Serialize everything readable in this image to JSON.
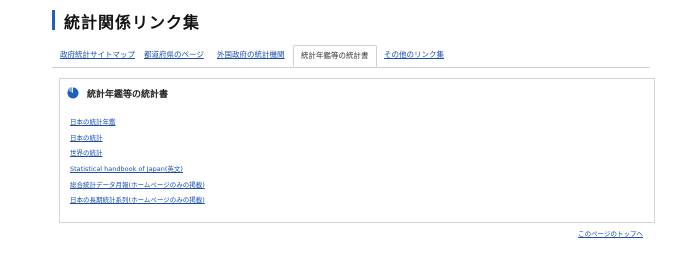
{
  "page": {
    "title": "統計関係リンク集"
  },
  "tabs": [
    {
      "label": "政府統計サイトマップ"
    },
    {
      "label": "都道府県のページ"
    },
    {
      "label": "外国政府の統計機関"
    },
    {
      "label": "統計年鑑等の統計書",
      "active": true
    },
    {
      "label": "その他のリンク集"
    }
  ],
  "section": {
    "title": "統計年鑑等の統計書",
    "icon": "pie-chart-icon",
    "links": [
      {
        "label": "日本の統計年鑑"
      },
      {
        "label": "日本の統計"
      },
      {
        "label": "世界の統計"
      },
      {
        "label": "Statistical handbook of Japan(英文)"
      },
      {
        "label": "総合統計データ月報(ホームページのみの掲載)"
      },
      {
        "label": "日本の長期統計系列(ホームページのみの掲載)"
      }
    ]
  },
  "footer": {
    "page_top": "このページのトップへ"
  },
  "colors": {
    "accent": "#1f5fbf",
    "link": "#1a4fb0",
    "border": "#d0d0d0"
  }
}
